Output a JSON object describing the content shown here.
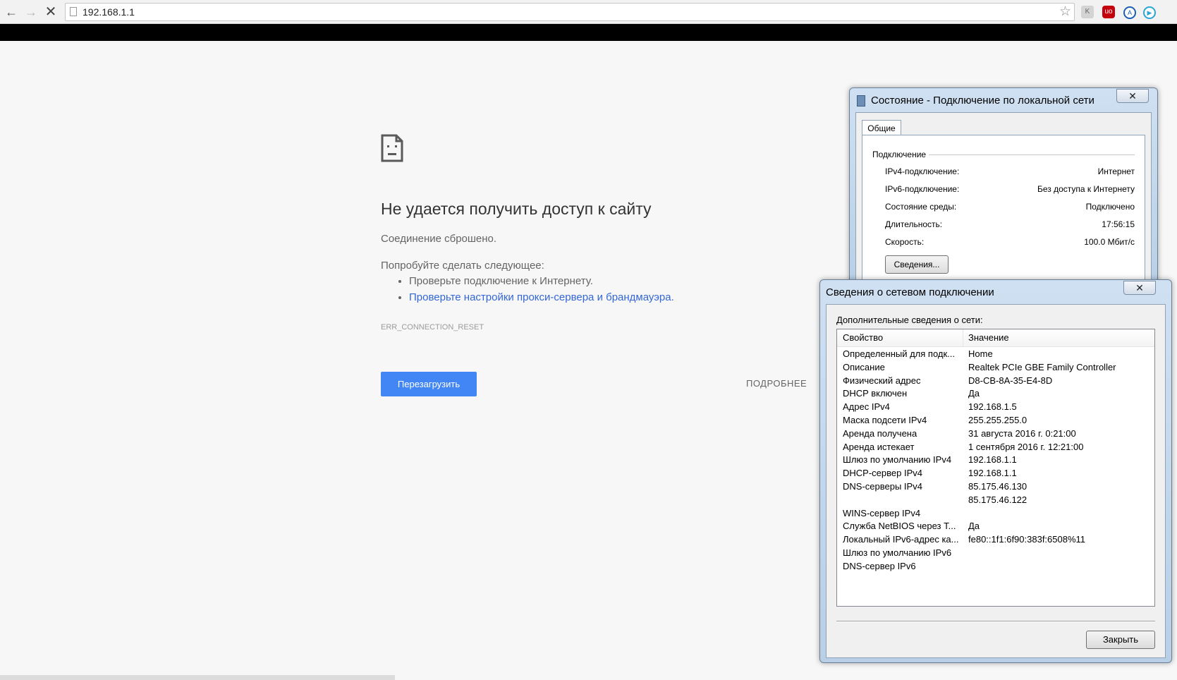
{
  "browser": {
    "url": "192.168.1.1",
    "icons": [
      "back-icon",
      "forward-icon",
      "stop-icon",
      "page-icon",
      "star-icon"
    ]
  },
  "error_page": {
    "title": "Не удается получить доступ к сайту",
    "subtitle": "Соединение сброшено.",
    "try_heading": "Попробуйте сделать следующее:",
    "suggestions": [
      "Проверьте подключение к Интернету.",
      "Проверьте настройки прокси-сервера и брандмауэра."
    ],
    "suggestion_link_color": "#3367d6",
    "error_code": "ERR_CONNECTION_RESET",
    "reload_label": "Перезагрузить",
    "reload_color": "#4285f4",
    "details_label": "ПОДРОБНЕЕ"
  },
  "status_window": {
    "title": "Состояние - Подключение по локальной сети",
    "close_label": "✕",
    "tab_label": "Общие",
    "group_label": "Подключение",
    "rows": [
      {
        "label": "IPv4-подключение:",
        "value": "Интернет"
      },
      {
        "label": "IPv6-подключение:",
        "value": "Без доступа к Интернету"
      },
      {
        "label": "Состояние среды:",
        "value": "Подключено"
      },
      {
        "label": "Длительность:",
        "value": "17:56:15"
      },
      {
        "label": "Скорость:",
        "value": "100.0 Мбит/с"
      }
    ],
    "details_button": "Сведения..."
  },
  "details_window": {
    "title": "Сведения о сетевом подключении",
    "close_label": "✕",
    "extra_label": "Дополнительные сведения о сети:",
    "columns": [
      "Свойство",
      "Значение"
    ],
    "rows": [
      {
        "property": "Определенный для подк...",
        "value": "Home"
      },
      {
        "property": "Описание",
        "value": "Realtek PCIe GBE Family Controller"
      },
      {
        "property": "Физический адрес",
        "value": "D8-CB-8A-35-E4-8D"
      },
      {
        "property": "DHCP включен",
        "value": "Да"
      },
      {
        "property": "Адрес IPv4",
        "value": "192.168.1.5"
      },
      {
        "property": "Маска подсети IPv4",
        "value": "255.255.255.0"
      },
      {
        "property": "Аренда получена",
        "value": "31 августа 2016 г. 0:21:00"
      },
      {
        "property": "Аренда истекает",
        "value": "1 сентября 2016 г. 12:21:00"
      },
      {
        "property": "Шлюз по умолчанию IPv4",
        "value": "192.168.1.1"
      },
      {
        "property": "DHCP-сервер IPv4",
        "value": "192.168.1.1"
      },
      {
        "property": "DNS-серверы IPv4",
        "value": "85.175.46.130"
      },
      {
        "property": "",
        "value": "85.175.46.122"
      },
      {
        "property": "WINS-сервер IPv4",
        "value": ""
      },
      {
        "property": "Служба NetBIOS через Т...",
        "value": "Да"
      },
      {
        "property": "Локальный IPv6-адрес ка...",
        "value": "fe80::1f1:6f90:383f:6508%11"
      },
      {
        "property": "Шлюз по умолчанию IPv6",
        "value": ""
      },
      {
        "property": "DNS-сервер IPv6",
        "value": ""
      }
    ],
    "close_button": "Закрыть"
  }
}
